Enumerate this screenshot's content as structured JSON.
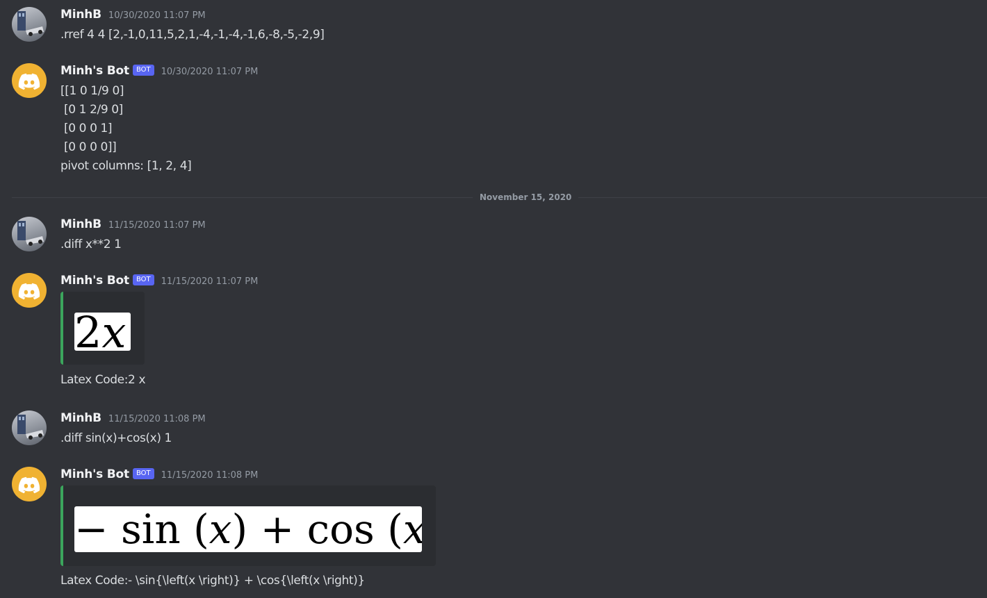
{
  "messages": [
    {
      "author": "MinhB",
      "timestamp": "10/30/2020 11:07 PM",
      "lines": [
        ".rref 4 4 [2,-1,0,11,5,2,1,-4,-1,-4,-1,6,-8,-5,-2,9]"
      ]
    },
    {
      "author": "Minh's Bot",
      "bot_tag": "BOT",
      "timestamp": "10/30/2020 11:07 PM",
      "lines": [
        "[[1 0 1/9 0]",
        " [0 1 2/9 0]",
        " [0 0 0 1]",
        " [0 0 0 0]]",
        "pivot columns: [1, 2, 4]"
      ]
    },
    {
      "author": "MinhB",
      "timestamp": "11/15/2020 11:07 PM",
      "lines": [
        ".diff x**2 1"
      ]
    },
    {
      "author": "Minh's Bot",
      "bot_tag": "BOT",
      "timestamp": "11/15/2020 11:07 PM",
      "embed_latex": [
        "2",
        "x"
      ],
      "latex_code": "Latex Code:2 x"
    },
    {
      "author": "MinhB",
      "timestamp": "11/15/2020 11:08 PM",
      "lines": [
        ".diff sin(x)+cos(x) 1"
      ]
    },
    {
      "author": "Minh's Bot",
      "bot_tag": "BOT",
      "timestamp": "11/15/2020 11:08 PM",
      "embed_latex": [
        "− sin (",
        "x",
        ") + cos (",
        "x",
        ")"
      ],
      "latex_code": "Latex Code:- \\sin{\\left(x \\right)} + \\cos{\\left(x \\right)}"
    }
  ],
  "date_divider": "November 15, 2020",
  "colors": {
    "background": "#313338",
    "bot_tag": "#5865f2",
    "embed_border": "#3ba55c",
    "bot_avatar": "#f0b232"
  }
}
